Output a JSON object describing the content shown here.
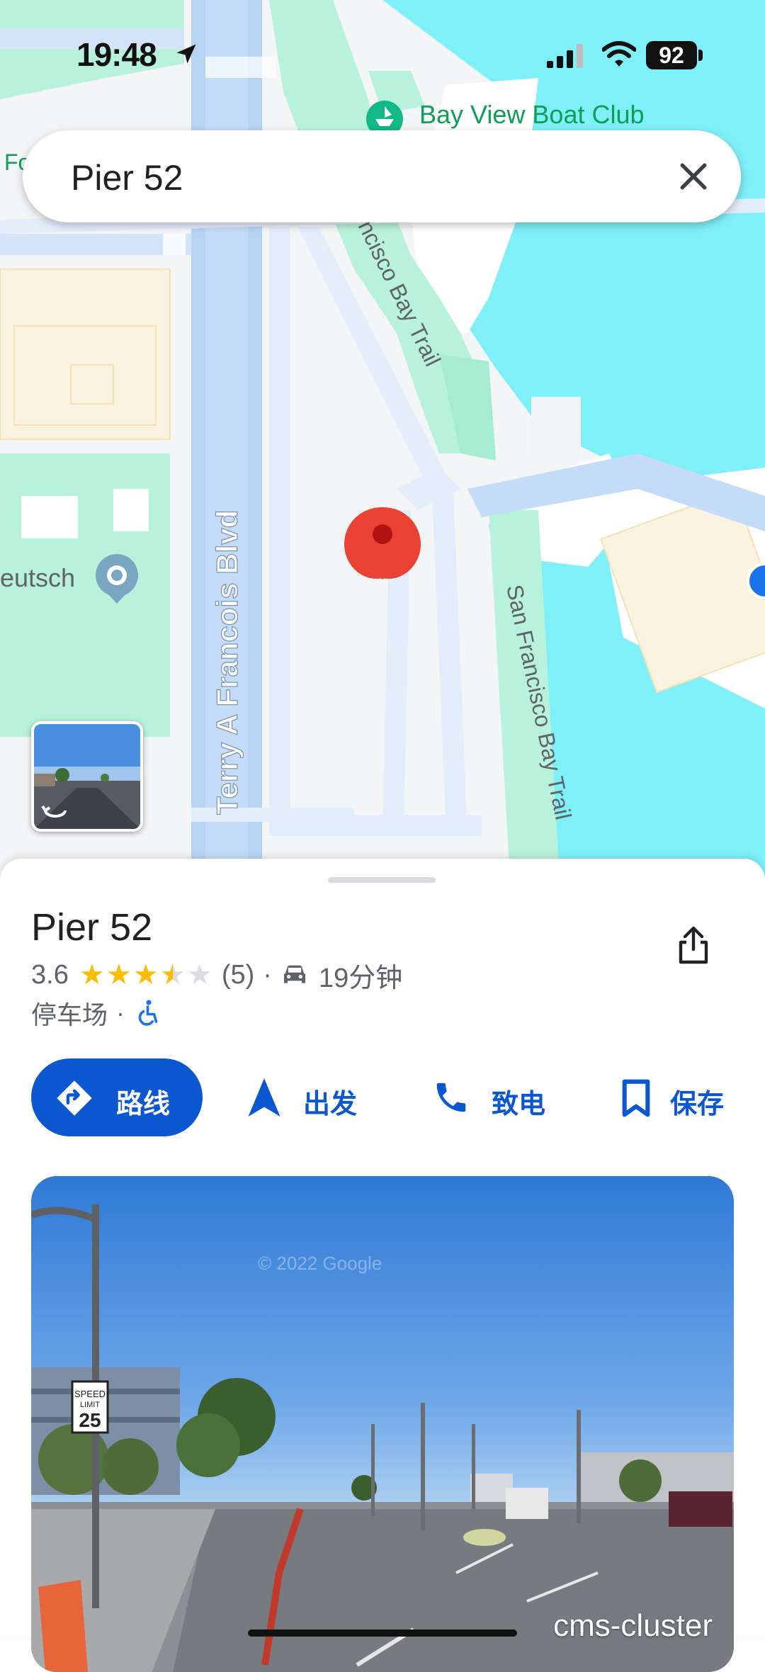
{
  "status_bar": {
    "time": "19:48",
    "battery": "92"
  },
  "map": {
    "labels": {
      "boat_club": "Bay View Boat Club",
      "bay_trail_top": "ncisco Bay Trail",
      "bay_trail_right": "San Francisco Bay Trail",
      "terry_blvd": "Terry A Francois Blvd",
      "deutsch": "eutsch",
      "edge_left": "Fo"
    },
    "icons": [
      "location-pin-icon",
      "boat-club-icon",
      "transit-marker-icon",
      "street-view-icon"
    ]
  },
  "search": {
    "query": "Pier 52",
    "clear_icon": "close-icon"
  },
  "place": {
    "name": "Pier 52",
    "rating": "3.6",
    "rating_value": 3.6,
    "reviews": "(5)",
    "separator": "·",
    "drive_time": "19分钟",
    "category": "停车场",
    "category_separator": "·"
  },
  "actions": {
    "route": "路线",
    "start": "出发",
    "call": "致电",
    "save": "保存"
  },
  "photo": {
    "label": "cms-cluster",
    "credit": "© 2022 Google"
  },
  "colors": {
    "accent": "#0b57d0",
    "water": "#7ff0f8",
    "park": "#b9f2dc",
    "road": "#b8d4f5",
    "pin": "#ea4335",
    "star": "#fbbc04"
  }
}
